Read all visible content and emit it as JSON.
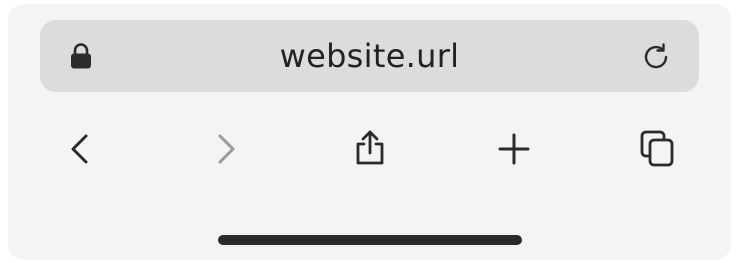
{
  "address_bar": {
    "url": "website.url",
    "lock_icon": "lock-icon",
    "reload_icon": "reload-icon"
  },
  "toolbar": {
    "back_icon": "chevron-left-icon",
    "forward_icon": "chevron-right-icon",
    "forward_enabled": false,
    "share_icon": "share-icon",
    "new_tab_icon": "plus-icon",
    "tabs_icon": "tabs-icon"
  },
  "colors": {
    "panel": "#f4f4f4",
    "address_bar": "#dcdcdc",
    "icon": "#2b2b2b",
    "icon_disabled": "#9a9a9a",
    "home_indicator": "#2a2a2a"
  }
}
